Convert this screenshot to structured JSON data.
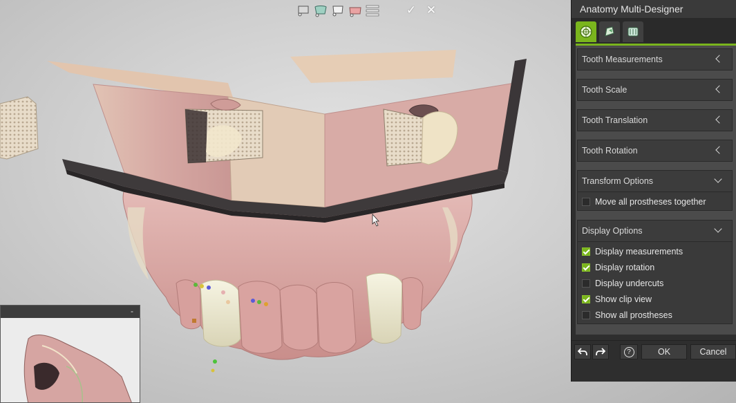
{
  "window": {
    "title": "Anatomy Multi-Designer"
  },
  "toolbar": {
    "icons": [
      "die-stone-icon",
      "gingiva-icon",
      "crown-icon",
      "prosthesis-icon",
      "sliders-icon"
    ],
    "confirm_symbol": "✓",
    "close_symbol": "✕"
  },
  "tabs": [
    {
      "icon": "anatomy-tooth-icon",
      "active": true
    },
    {
      "icon": "free-form-icon",
      "active": false
    },
    {
      "icon": "teeth-row-icon",
      "active": false
    }
  ],
  "sections": {
    "tooth_measurements": "Tooth Measurements",
    "tooth_scale": "Tooth Scale",
    "tooth_translation": "Tooth Translation",
    "tooth_rotation": "Tooth Rotation",
    "transform_options": {
      "label": "Transform Options",
      "options": [
        {
          "label": "Move all prostheses together",
          "checked": false
        }
      ]
    },
    "display_options": {
      "label": "Display Options",
      "options": [
        {
          "label": "Display measurements",
          "checked": true
        },
        {
          "label": "Display rotation",
          "checked": true
        },
        {
          "label": "Display undercuts",
          "checked": false
        },
        {
          "label": "Show clip view",
          "checked": true
        },
        {
          "label": "Show all prostheses",
          "checked": false
        }
      ]
    }
  },
  "buttons": {
    "undo_icon": "undo-arrow-icon",
    "redo_icon": "redo-arrow-icon",
    "help_symbol": "?",
    "ok": "OK",
    "cancel": "Cancel"
  },
  "mini_view": {
    "minimize_symbol": "-"
  },
  "colors": {
    "accent": "#7ab51d",
    "panel_bg": "#2e2e2e",
    "gingiva": "#d9a3a0",
    "tooth": "#ece8cc"
  }
}
